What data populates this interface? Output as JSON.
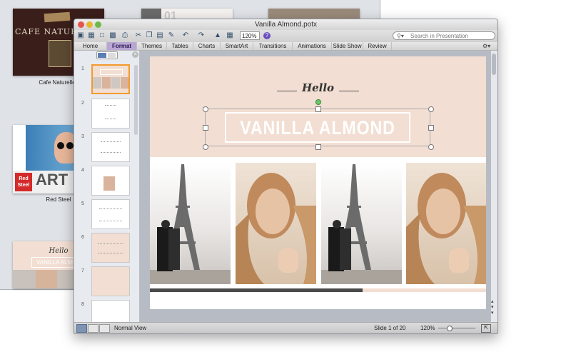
{
  "gallery": {
    "templates": [
      {
        "name": "Cafe Naturelle",
        "thumb_text": "CAFE NATURELLE"
      },
      {
        "name": "Red Steel",
        "thumb_text": "ART",
        "badge": "Red Steel"
      }
    ],
    "slide3_thumb_text": "01",
    "vanilla_thumb_hello": "Hello",
    "vanilla_thumb_title": "VANILLA ALMOND"
  },
  "window": {
    "title": "Vanilla Almond.potx",
    "zoom": "120%",
    "search_placeholder": "Search in Presentation"
  },
  "ribbon": {
    "tabs": [
      "Home",
      "Format",
      "Themes",
      "Tables",
      "Charts",
      "SmartArt",
      "Transitions",
      "Animations",
      "Slide Show",
      "Review"
    ],
    "active": "Format"
  },
  "slides": [
    {
      "number": "1"
    },
    {
      "number": "2"
    },
    {
      "number": "3"
    },
    {
      "number": "4"
    },
    {
      "number": "5"
    },
    {
      "number": "6"
    },
    {
      "number": "7"
    },
    {
      "number": "8"
    }
  ],
  "slide": {
    "hello": "Hello",
    "title": "VANILLA ALMOND"
  },
  "status": {
    "view": "Normal View",
    "slide_counter": "Slide 1 of 20",
    "zoom": "120%"
  },
  "colors": {
    "accent": "#f39a2e",
    "slide_bg": "#f2ded2",
    "ribbon_active": "#b9a6d3"
  }
}
